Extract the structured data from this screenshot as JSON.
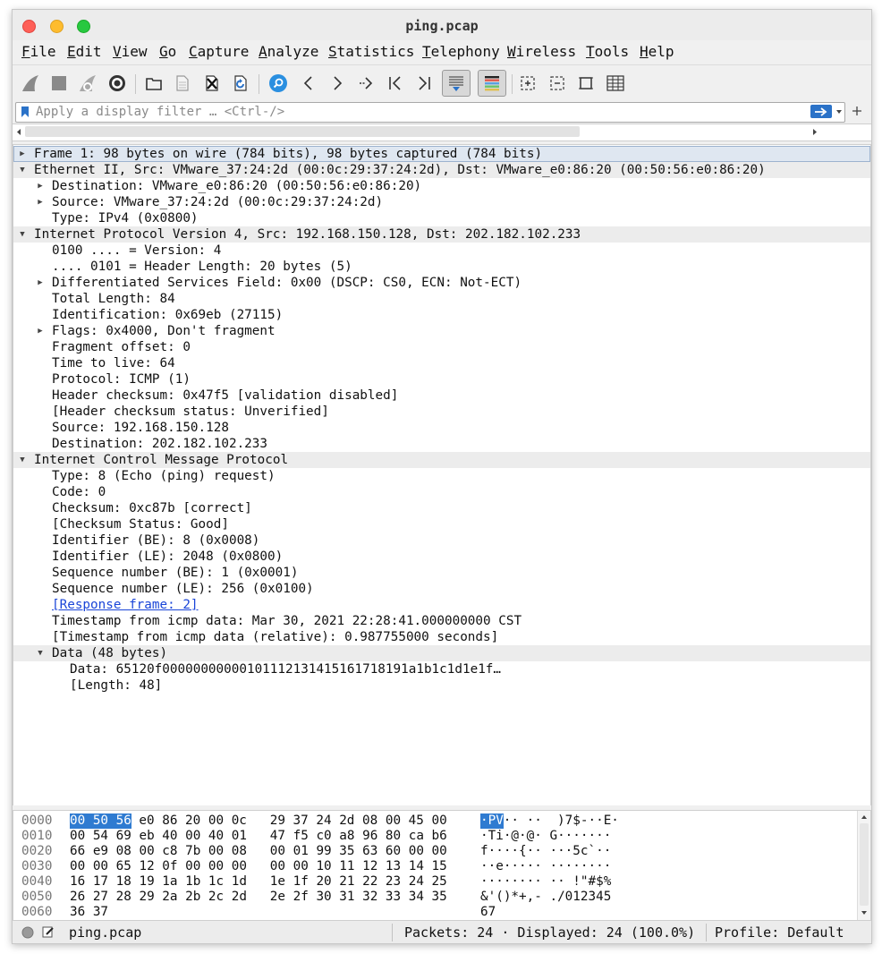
{
  "window": {
    "title": "ping.pcap"
  },
  "menu": [
    "File",
    "Edit",
    "View",
    "Go",
    "Capture",
    "Analyze",
    "Statistics",
    "Telephony",
    "Wireless",
    "Tools",
    "Help"
  ],
  "toolbar": {
    "icons": [
      "shark-fin-start-icon",
      "stop-icon",
      "shark-fin-restart-icon",
      "gear-options-icon",
      "open-folder-icon",
      "file-icon",
      "close-file-icon",
      "reload-icon",
      "find-packet-icon",
      "back-arrow-icon",
      "forward-arrow-icon",
      "go-to-packet-icon",
      "first-packet-icon",
      "last-packet-icon",
      "autoscroll-icon",
      "colorize-icon",
      "zoom-in-icon",
      "zoom-out-icon",
      "normal-size-icon",
      "resize-columns-icon"
    ]
  },
  "filter": {
    "placeholder": "Apply a display filter … <Ctrl-/>",
    "value": ""
  },
  "details": {
    "rows": [
      {
        "text": "Frame 1: 98 bytes on wire (784 bits), 98 bytes captured (784 bits)",
        "indent": 0,
        "expander": "collapsed",
        "style": "selected"
      },
      {
        "text": "Ethernet II, Src: VMware_37:24:2d (00:0c:29:37:24:2d), Dst: VMware_e0:86:20 (00:50:56:e0:86:20)",
        "indent": 0,
        "expander": "expanded",
        "style": "header"
      },
      {
        "text": "Destination: VMware_e0:86:20 (00:50:56:e0:86:20)",
        "indent": 1,
        "expander": "collapsed"
      },
      {
        "text": "Source: VMware_37:24:2d (00:0c:29:37:24:2d)",
        "indent": 1,
        "expander": "collapsed"
      },
      {
        "text": "Type: IPv4 (0x0800)",
        "indent": 1,
        "expander": "none"
      },
      {
        "text": "Internet Protocol Version 4, Src: 192.168.150.128, Dst: 202.182.102.233",
        "indent": 0,
        "expander": "expanded",
        "style": "header"
      },
      {
        "text": "0100 .... = Version: 4",
        "indent": 1,
        "expander": "none"
      },
      {
        "text": ".... 0101 = Header Length: 20 bytes (5)",
        "indent": 1,
        "expander": "none"
      },
      {
        "text": "Differentiated Services Field: 0x00 (DSCP: CS0, ECN: Not-ECT)",
        "indent": 1,
        "expander": "collapsed"
      },
      {
        "text": "Total Length: 84",
        "indent": 1,
        "expander": "none"
      },
      {
        "text": "Identification: 0x69eb (27115)",
        "indent": 1,
        "expander": "none"
      },
      {
        "text": "Flags: 0x4000, Don't fragment",
        "indent": 1,
        "expander": "collapsed"
      },
      {
        "text": "Fragment offset: 0",
        "indent": 1,
        "expander": "none"
      },
      {
        "text": "Time to live: 64",
        "indent": 1,
        "expander": "none"
      },
      {
        "text": "Protocol: ICMP (1)",
        "indent": 1,
        "expander": "none"
      },
      {
        "text": "Header checksum: 0x47f5 [validation disabled]",
        "indent": 1,
        "expander": "none"
      },
      {
        "text": "[Header checksum status: Unverified]",
        "indent": 1,
        "expander": "none"
      },
      {
        "text": "Source: 192.168.150.128",
        "indent": 1,
        "expander": "none"
      },
      {
        "text": "Destination: 202.182.102.233",
        "indent": 1,
        "expander": "none"
      },
      {
        "text": "Internet Control Message Protocol",
        "indent": 0,
        "expander": "expanded",
        "style": "header"
      },
      {
        "text": "Type: 8 (Echo (ping) request)",
        "indent": 1,
        "expander": "none"
      },
      {
        "text": "Code: 0",
        "indent": 1,
        "expander": "none"
      },
      {
        "text": "Checksum: 0xc87b [correct]",
        "indent": 1,
        "expander": "none"
      },
      {
        "text": "[Checksum Status: Good]",
        "indent": 1,
        "expander": "none"
      },
      {
        "text": "Identifier (BE): 8 (0x0008)",
        "indent": 1,
        "expander": "none"
      },
      {
        "text": "Identifier (LE): 2048 (0x0800)",
        "indent": 1,
        "expander": "none"
      },
      {
        "text": "Sequence number (BE): 1 (0x0001)",
        "indent": 1,
        "expander": "none"
      },
      {
        "text": "Sequence number (LE): 256 (0x0100)",
        "indent": 1,
        "expander": "none"
      },
      {
        "text": "[Response frame: 2]",
        "indent": 1,
        "expander": "none",
        "link": true
      },
      {
        "text": "Timestamp from icmp data: Mar 30, 2021 22:28:41.000000000 CST",
        "indent": 1,
        "expander": "none"
      },
      {
        "text": "[Timestamp from icmp data (relative): 0.987755000 seconds]",
        "indent": 1,
        "expander": "none"
      },
      {
        "text": "Data (48 bytes)",
        "indent": 1,
        "expander": "expanded",
        "style": "header"
      },
      {
        "text": "Data: 65120f00000000000101112131415161718191a1b1c1d1e1f…",
        "indent": 2,
        "expander": "none"
      },
      {
        "text": "[Length: 48]",
        "indent": 2,
        "expander": "none"
      }
    ]
  },
  "bytes": {
    "lines": [
      {
        "offset": "0000",
        "hex_sel": "00 50 56",
        "hex": " e0 86 20 00 0c   29 37 24 2d 08 00 45 00",
        "ascii_sel": "·PV",
        "ascii": "·· ··  )7$-··E·"
      },
      {
        "offset": "0010",
        "hex_sel": "",
        "hex": "00 54 69 eb 40 00 40 01   47 f5 c0 a8 96 80 ca b6",
        "ascii_sel": "",
        "ascii": "·Ti·@·@· G·······"
      },
      {
        "offset": "0020",
        "hex_sel": "",
        "hex": "66 e9 08 00 c8 7b 00 08   00 01 99 35 63 60 00 00",
        "ascii_sel": "",
        "ascii": "f····{·· ···5c`··"
      },
      {
        "offset": "0030",
        "hex_sel": "",
        "hex": "00 00 65 12 0f 00 00 00   00 00 10 11 12 13 14 15",
        "ascii_sel": "",
        "ascii": "··e····· ········"
      },
      {
        "offset": "0040",
        "hex_sel": "",
        "hex": "16 17 18 19 1a 1b 1c 1d   1e 1f 20 21 22 23 24 25",
        "ascii_sel": "",
        "ascii": "········ ·· !\"#$%"
      },
      {
        "offset": "0050",
        "hex_sel": "",
        "hex": "26 27 28 29 2a 2b 2c 2d   2e 2f 30 31 32 33 34 35",
        "ascii_sel": "",
        "ascii": "&'()*+,- ./012345"
      },
      {
        "offset": "0060",
        "hex_sel": "",
        "hex": "36 37",
        "ascii_sel": "",
        "ascii": "67"
      }
    ]
  },
  "status": {
    "file": "ping.pcap",
    "packets": "Packets: 24 · Displayed: 24 (100.0%)",
    "profile": "Profile: Default"
  }
}
